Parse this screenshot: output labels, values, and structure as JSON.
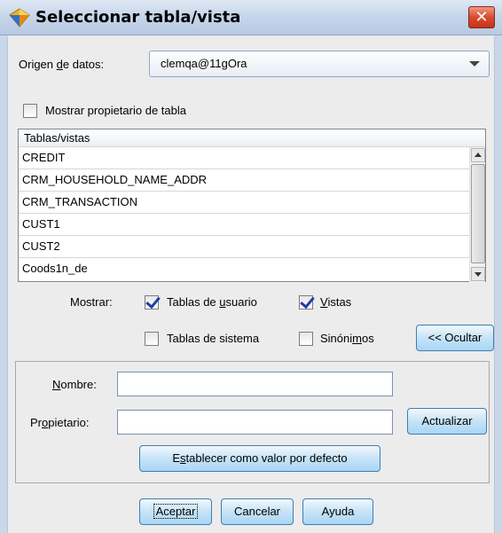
{
  "window": {
    "title": "Seleccionar tabla/vista",
    "close_glyph": "✕",
    "icon": "diamond-app-icon"
  },
  "datasource": {
    "label_pre": "Origen ",
    "label_ul": "d",
    "label_post": "e datos:",
    "value": "clemqa@11gOra"
  },
  "show_owner": {
    "label": "Mostrar propietario de tabla",
    "checked": false
  },
  "tables_list": {
    "header": "Tablas/vistas",
    "items": [
      "CREDIT",
      "CRM_HOUSEHOLD_NAME_ADDR",
      "CRM_TRANSACTION",
      "CUST1",
      "CUST2",
      "Coods1n_de"
    ]
  },
  "show": {
    "label": "Mostrar:",
    "user_tables": {
      "pre": "Tablas de ",
      "ul": "u",
      "post": "suario",
      "checked": true
    },
    "views": {
      "pre": "",
      "ul": "V",
      "post": "istas",
      "checked": true
    },
    "system_tables": {
      "label": "Tablas de sistema",
      "checked": false
    },
    "synonyms": {
      "pre": "Sinóni",
      "ul": "m",
      "post": "os",
      "checked": false
    },
    "hide_button": "<< Ocultar"
  },
  "filter": {
    "name_pre": "",
    "name_ul": "N",
    "name_post": "ombre:",
    "name_value": "",
    "owner_pre": "Pr",
    "owner_ul": "o",
    "owner_post": "pietario:",
    "owner_value": "",
    "refresh_button": "Actualizar",
    "default_pre": "E",
    "default_ul": "s",
    "default_post": "tablecer como valor por defecto"
  },
  "footer": {
    "ok": "Aceptar",
    "cancel": "Cancelar",
    "help": "Ayuda"
  },
  "colors": {
    "accent": "#3c7fb1",
    "check": "#1f3fa6",
    "close": "#d94a2f"
  }
}
